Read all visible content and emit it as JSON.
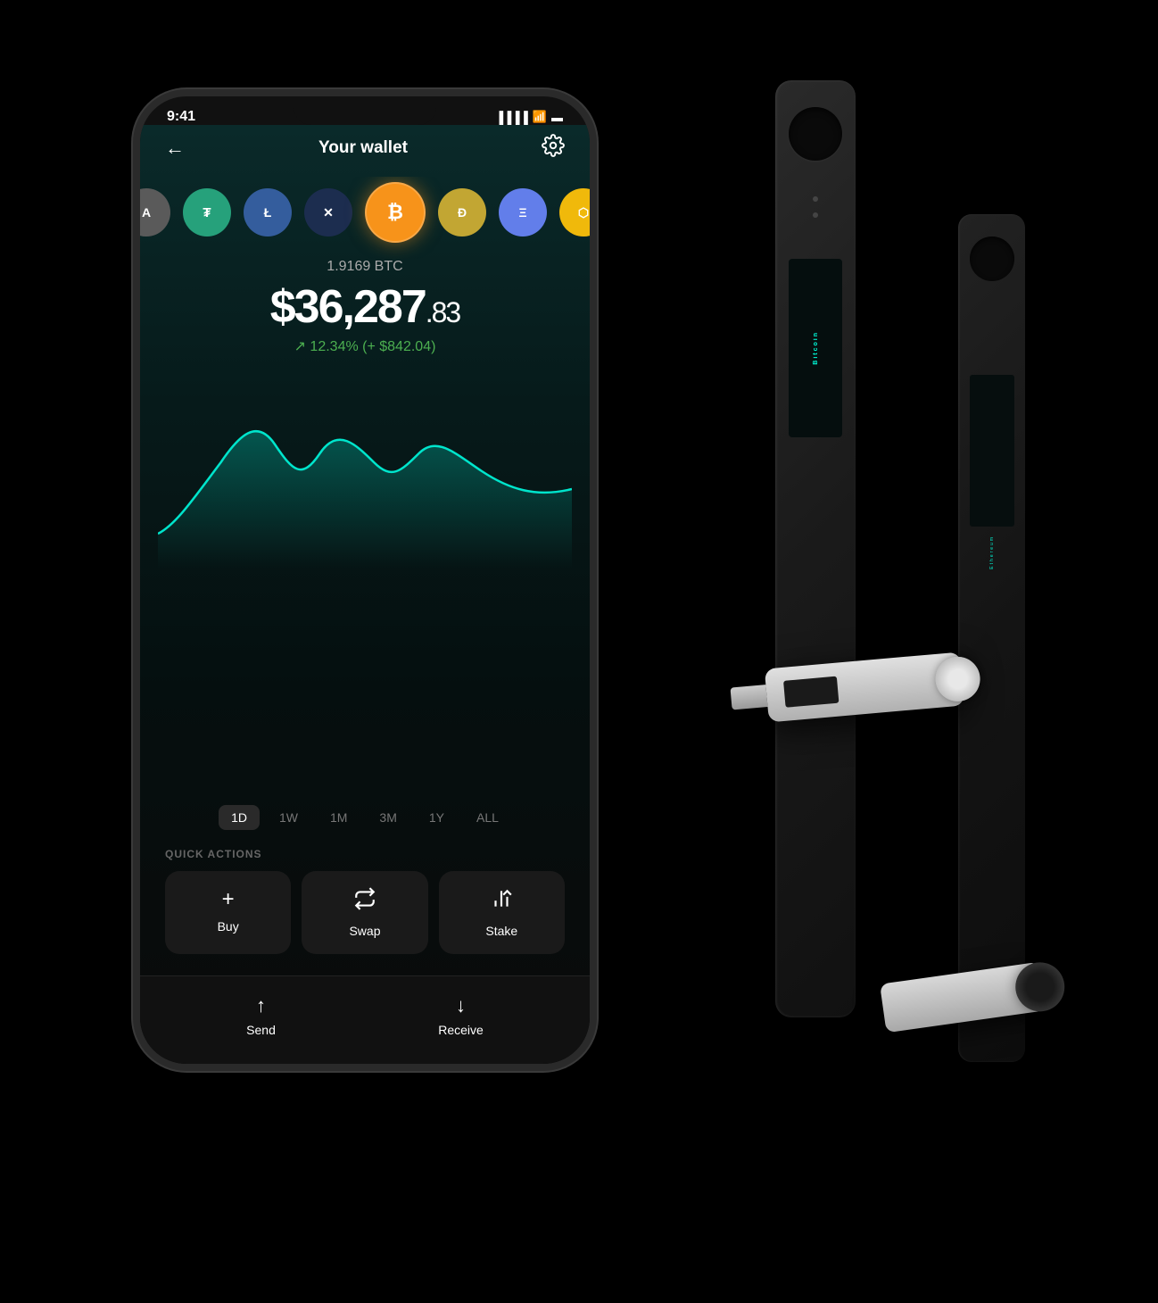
{
  "statusBar": {
    "time": "9:41",
    "signal": "●●●▪",
    "wifi": "wifi",
    "battery": "battery"
  },
  "nav": {
    "back": "←",
    "title": "Your wallet",
    "settings": "⚙"
  },
  "coins": [
    {
      "id": "algo",
      "symbol": "A",
      "class": "coin-algo"
    },
    {
      "id": "tether",
      "symbol": "₮",
      "class": "coin-tether"
    },
    {
      "id": "litecoin",
      "symbol": "Ł",
      "class": "coin-litecoin"
    },
    {
      "id": "xrp",
      "symbol": "✕",
      "class": "coin-xrp"
    },
    {
      "id": "bitcoin",
      "symbol": "₿",
      "class": "coin-bitcoin"
    },
    {
      "id": "doge",
      "symbol": "Ð",
      "class": "coin-doge"
    },
    {
      "id": "ethereum",
      "symbol": "Ξ",
      "class": "coin-ethereum"
    },
    {
      "id": "bnb",
      "symbol": "⬡",
      "class": "coin-bnb"
    }
  ],
  "balance": {
    "crypto": "1.9169 BTC",
    "fiatMain": "$36,287",
    "fiatCents": ".83",
    "change": "↗ 12.34% (+ $842.04)"
  },
  "timeFilters": [
    {
      "label": "1D",
      "active": true
    },
    {
      "label": "1W",
      "active": false
    },
    {
      "label": "1M",
      "active": false
    },
    {
      "label": "3M",
      "active": false
    },
    {
      "label": "1Y",
      "active": false
    },
    {
      "label": "ALL",
      "active": false
    }
  ],
  "quickActions": {
    "sectionLabel": "QUICK ACTIONS",
    "actions": [
      {
        "id": "buy",
        "icon": "+",
        "label": "Buy"
      },
      {
        "id": "swap",
        "icon": "⇄",
        "label": "Swap"
      },
      {
        "id": "stake",
        "icon": "↑↑",
        "label": "Stake"
      }
    ]
  },
  "bottomActions": [
    {
      "id": "send",
      "icon": "↑",
      "label": "Send"
    },
    {
      "id": "receive",
      "icon": "↓",
      "label": "Receive"
    }
  ],
  "ledger": {
    "device1": {
      "label": "Bitcoin"
    },
    "device2": {
      "label": "Ethereum"
    }
  }
}
